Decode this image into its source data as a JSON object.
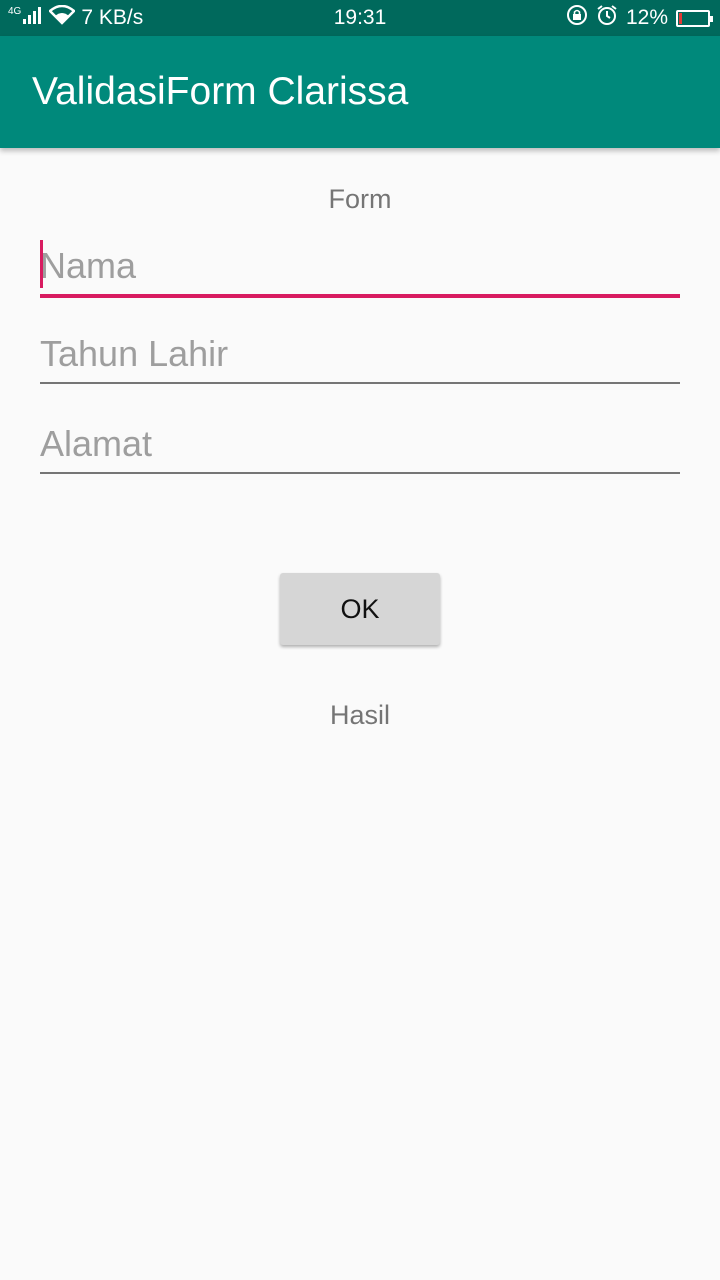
{
  "status_bar": {
    "network_type": "4G",
    "speed": "7 KB/s",
    "time": "19:31",
    "battery_percent": "12%",
    "battery_level": 0.12,
    "icons": [
      "signal-icon",
      "wifi-icon",
      "rotation-lock-icon",
      "alarm-icon",
      "battery-icon"
    ]
  },
  "app_bar": {
    "title": "ValidasiForm Clarissa",
    "color": "#00897b"
  },
  "form": {
    "heading": "Form",
    "fields": [
      {
        "placeholder": "Nama",
        "value": "",
        "focused": true
      },
      {
        "placeholder": "Tahun Lahir",
        "value": "",
        "focused": false
      },
      {
        "placeholder": "Alamat",
        "value": "",
        "focused": false
      }
    ],
    "ok_label": "OK",
    "result_label": "Hasil",
    "accent_color": "#d81b60"
  }
}
